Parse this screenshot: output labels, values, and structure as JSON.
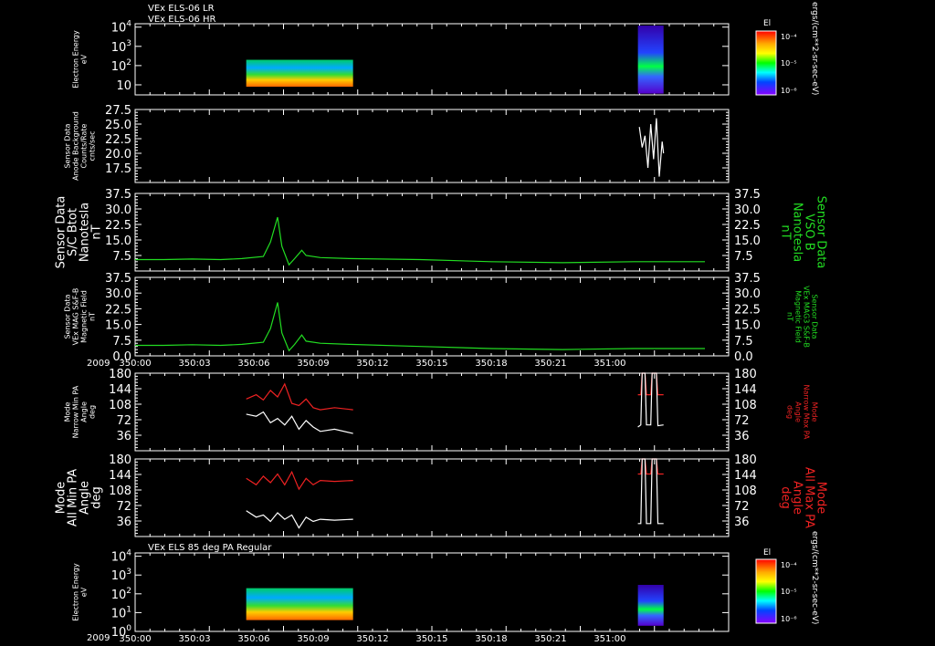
{
  "header": {
    "lines": [
      "VEx ELS-06 LR",
      "VEx ELS-06 HR"
    ]
  },
  "bottom_header": "VEx ELS 85 deg PA Regular",
  "colors": {
    "background": "#000000",
    "axis": "#ffffff",
    "green": "#22dd22",
    "red": "#ee2222",
    "white": "#ffffff"
  },
  "colorbars": [
    {
      "title": "El",
      "ticks": [
        "10⁻⁴",
        "10⁻⁵",
        "10⁻⁶"
      ],
      "unit": "ergs/(cm**2-sr-sec-eV)"
    },
    {
      "title": "El",
      "ticks": [
        "10⁻⁴",
        "10⁻⁵",
        "10⁻⁶"
      ],
      "unit": "ergs/(cm**2-sr-sec-eV)"
    }
  ],
  "chart_data": [
    {
      "type": "heatmap",
      "panel": "energy_top",
      "ylabel": [
        "Electron Energy",
        "eV"
      ],
      "yscale": "log",
      "ylim": [
        3,
        15000
      ],
      "yticks": [
        {
          "value": 10000,
          "base": "10",
          "exp": "4"
        },
        {
          "value": 1000,
          "base": "10",
          "exp": "3"
        },
        {
          "value": 100,
          "base": "10",
          "exp": "2"
        },
        {
          "value": 10,
          "base": "10",
          "exp": ""
        }
      ],
      "blocks": [
        {
          "x0": 350.078,
          "x1": 350.153,
          "y0": 8,
          "y1": 200,
          "style": "fluxA"
        },
        {
          "x0": 350.353,
          "x1": 350.371,
          "y0": 3.5,
          "y1": 12000,
          "style": "fluxB"
        }
      ]
    },
    {
      "type": "line",
      "panel": "background",
      "ylabel": [
        "Sensor Data",
        "Anode Background",
        "Counts/Rate",
        "cnts/sec"
      ],
      "ylim": [
        15,
        27.5
      ],
      "yticks": [
        "27.5",
        "25.0",
        "22.5",
        "20.0",
        "17.5"
      ],
      "series": [
        {
          "color": "white",
          "x": [
            350.354,
            350.356,
            350.358,
            350.36,
            350.362,
            350.364,
            350.366,
            350.368,
            350.37,
            350.371
          ],
          "y": [
            24.5,
            21,
            23,
            17.5,
            25,
            19,
            26,
            16,
            22,
            20
          ]
        }
      ]
    },
    {
      "type": "line",
      "panel": "scbtot",
      "ylabel": [
        "Sensor Data",
        "S/C Btot",
        "Nanotesla",
        "nT"
      ],
      "ylabel_right": [
        "Sensor Data",
        "VSO B",
        "Nanotesla",
        "nT"
      ],
      "ylim": [
        0,
        37.5
      ],
      "yticks": [
        "37.5",
        "30.0",
        "22.5",
        "15.0",
        "7.5"
      ],
      "series": [
        {
          "color": "green",
          "x": [
            350.0,
            350.02,
            350.04,
            350.06,
            350.075,
            350.09,
            350.095,
            350.1,
            350.103,
            350.108,
            350.112,
            350.117,
            350.12,
            350.13,
            350.15,
            350.2,
            350.25,
            350.3,
            350.35,
            350.4
          ],
          "y": [
            5.5,
            5.5,
            5.8,
            5.5,
            6.0,
            7.0,
            14.0,
            26.0,
            12.0,
            3.0,
            6.0,
            10.0,
            7.5,
            6.5,
            6.0,
            5.5,
            4.5,
            4.0,
            4.5,
            4.5
          ]
        }
      ]
    },
    {
      "type": "line",
      "panel": "mag",
      "ylabel": [
        "Sensor Data",
        "VEx MAG S&F-B",
        "Magnetic Field",
        "nT"
      ],
      "ylabel_right": [
        "Sensor Data",
        "VEx MAG3 S&F-B",
        "Magnetic Field",
        "nT"
      ],
      "ylim": [
        0,
        37.5
      ],
      "yticks": [
        "37.5",
        "30.0",
        "22.5",
        "15.0",
        "7.5",
        "0.0"
      ],
      "series": [
        {
          "color": "green",
          "x": [
            350.0,
            350.02,
            350.04,
            350.06,
            350.075,
            350.09,
            350.095,
            350.1,
            350.103,
            350.108,
            350.112,
            350.117,
            350.12,
            350.13,
            350.15,
            350.2,
            350.25,
            350.3,
            350.35,
            350.4
          ],
          "y": [
            5.0,
            5.0,
            5.3,
            5.0,
            5.5,
            6.5,
            13.0,
            25.5,
            11.0,
            2.5,
            5.5,
            10.0,
            7.0,
            6.0,
            5.5,
            4.5,
            3.5,
            3.0,
            3.5,
            3.5
          ]
        }
      ]
    },
    {
      "type": "line",
      "panel": "narrow_pa",
      "ylabel": [
        "Mode",
        "Narrow Min PA",
        "Angle",
        "deg"
      ],
      "ylabel_right": [
        "Mode",
        "Narrow Max PA",
        "Angle",
        "deg"
      ],
      "ylim": [
        0,
        180
      ],
      "yticks": [
        "180",
        "144",
        "108",
        "72",
        "36"
      ],
      "series": [
        {
          "color": "red",
          "x": [
            350.078,
            350.085,
            350.09,
            350.095,
            350.1,
            350.105,
            350.11,
            350.115,
            350.12,
            350.125,
            350.13,
            350.14,
            350.153
          ],
          "y": [
            120,
            130,
            118,
            140,
            125,
            155,
            110,
            105,
            120,
            100,
            95,
            100,
            95
          ]
        },
        {
          "color": "white",
          "x": [
            350.078,
            350.085,
            350.09,
            350.095,
            350.1,
            350.105,
            350.11,
            350.115,
            350.12,
            350.125,
            350.13,
            350.14,
            350.153
          ],
          "y": [
            85,
            80,
            90,
            65,
            75,
            60,
            80,
            50,
            70,
            55,
            45,
            50,
            40
          ]
        },
        {
          "color": "red",
          "x": [
            350.353,
            350.355,
            350.356,
            350.358,
            350.359,
            350.362,
            350.363,
            350.366,
            350.367,
            350.371
          ],
          "y": [
            130,
            130,
            180,
            180,
            130,
            130,
            180,
            180,
            130,
            130
          ]
        },
        {
          "color": "white",
          "x": [
            350.353,
            350.355,
            350.356,
            350.358,
            350.359,
            350.362,
            350.363,
            350.366,
            350.367,
            350.371
          ],
          "y": [
            55,
            60,
            180,
            180,
            60,
            60,
            180,
            180,
            58,
            60
          ]
        }
      ]
    },
    {
      "type": "line",
      "panel": "all_pa",
      "ylabel": [
        "Mode",
        "All Min PA",
        "Angle",
        "deg"
      ],
      "ylabel_right": [
        "Mode",
        "All Max PA",
        "Angle",
        "deg"
      ],
      "ylim": [
        0,
        180
      ],
      "yticks": [
        "180",
        "144",
        "108",
        "72",
        "36"
      ],
      "series": [
        {
          "color": "red",
          "x": [
            350.078,
            350.085,
            350.09,
            350.095,
            350.1,
            350.105,
            350.11,
            350.115,
            350.12,
            350.125,
            350.13,
            350.14,
            350.153
          ],
          "y": [
            135,
            120,
            140,
            125,
            145,
            120,
            150,
            110,
            135,
            120,
            130,
            128,
            130
          ]
        },
        {
          "color": "white",
          "x": [
            350.078,
            350.085,
            350.09,
            350.095,
            350.1,
            350.105,
            350.11,
            350.115,
            350.12,
            350.125,
            350.13,
            350.14,
            350.153
          ],
          "y": [
            60,
            45,
            50,
            35,
            55,
            40,
            50,
            20,
            45,
            35,
            40,
            38,
            40
          ]
        },
        {
          "color": "red",
          "x": [
            350.353,
            350.355,
            350.356,
            350.358,
            350.359,
            350.362,
            350.363,
            350.366,
            350.367,
            350.371
          ],
          "y": [
            145,
            145,
            180,
            180,
            145,
            145,
            180,
            180,
            145,
            145
          ]
        },
        {
          "color": "white",
          "x": [
            350.353,
            350.355,
            350.356,
            350.358,
            350.359,
            350.362,
            350.363,
            350.366,
            350.367,
            350.371
          ],
          "y": [
            30,
            30,
            180,
            180,
            30,
            30,
            180,
            180,
            30,
            30
          ]
        }
      ]
    },
    {
      "type": "heatmap",
      "panel": "energy_bottom",
      "ylabel": [
        "Electron Energy",
        "eV"
      ],
      "yscale": "log",
      "ylim": [
        1,
        15000
      ],
      "yticks": [
        {
          "value": 10000,
          "base": "10",
          "exp": "4"
        },
        {
          "value": 1000,
          "base": "10",
          "exp": "3"
        },
        {
          "value": 100,
          "base": "10",
          "exp": "2"
        },
        {
          "value": 10,
          "base": "10",
          "exp": "1"
        },
        {
          "value": 1,
          "base": "10",
          "exp": "0"
        }
      ],
      "blocks": [
        {
          "x0": 350.078,
          "x1": 350.153,
          "y0": 4,
          "y1": 200,
          "style": "fluxA"
        },
        {
          "x0": 350.353,
          "x1": 350.371,
          "y0": 2,
          "y1": 300,
          "style": "fluxB"
        }
      ]
    }
  ],
  "xaxis": {
    "xlim": [
      350.0,
      350.4167
    ],
    "ticks": [
      {
        "value": 350.0,
        "label": "350:00"
      },
      {
        "value": 350.0417,
        "label": "350:03"
      },
      {
        "value": 350.0833,
        "label": "350:06"
      },
      {
        "value": 350.125,
        "label": "350:09"
      },
      {
        "value": 350.1667,
        "label": "350:12"
      },
      {
        "value": 350.2083,
        "label": "350:15"
      },
      {
        "value": 350.25,
        "label": "350:18"
      },
      {
        "value": 350.2917,
        "label": "350:21"
      },
      {
        "value": 350.3333,
        "label": "351:00"
      }
    ],
    "year": "2009"
  }
}
